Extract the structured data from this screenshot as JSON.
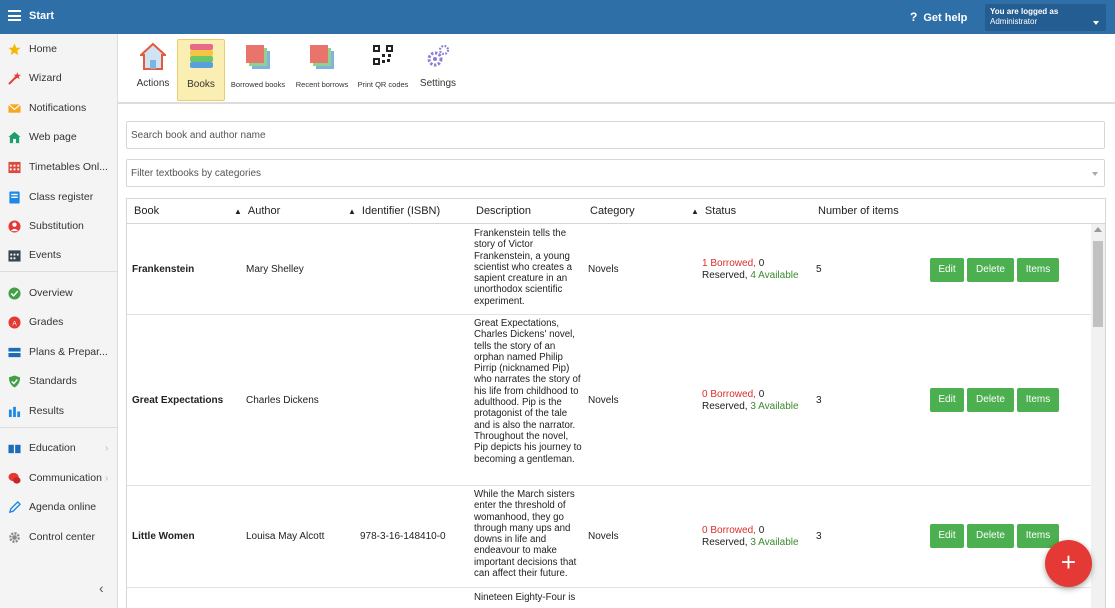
{
  "topbar": {
    "title": "Start",
    "help_q": "?",
    "help": "Get help",
    "logged_as": "You are logged as",
    "user": "Administrator"
  },
  "sidebar": {
    "items": [
      {
        "label": "Home",
        "icon": "star-icon"
      },
      {
        "label": "Wizard",
        "icon": "wand-icon"
      },
      {
        "label": "Notifications",
        "icon": "envelope-icon"
      },
      {
        "label": "Web page",
        "icon": "home-icon"
      },
      {
        "label": "Timetables Onl...",
        "icon": "calendar-icon"
      },
      {
        "label": "Class register",
        "icon": "book-icon"
      },
      {
        "label": "Substitution",
        "icon": "person-icon"
      },
      {
        "label": "Events",
        "icon": "events-icon"
      },
      {
        "label": "Overview",
        "icon": "check-circle-icon"
      },
      {
        "label": "Grades",
        "icon": "grades-icon"
      },
      {
        "label": "Plans & Prepar...",
        "icon": "plans-icon"
      },
      {
        "label": "Standards",
        "icon": "shield-icon"
      },
      {
        "label": "Results",
        "icon": "bar-chart-icon"
      },
      {
        "label": "Education",
        "icon": "education-icon"
      },
      {
        "label": "Communication",
        "icon": "chat-icon"
      },
      {
        "label": "Agenda online",
        "icon": "pen-icon"
      },
      {
        "label": "Control center",
        "icon": "gear-icon"
      }
    ],
    "chevron": "›",
    "collapse": "‹"
  },
  "toolbar": {
    "actions": "Actions",
    "books": "Books",
    "borrowed": "Borrowed books",
    "recent": "Recent borrows",
    "qr": "Print QR codes",
    "settings": "Settings"
  },
  "search": {
    "placeholder": "Search book and author name"
  },
  "filter": {
    "placeholder": "Filter textbooks by categories"
  },
  "table": {
    "headers": {
      "book": "Book",
      "author": "Author",
      "isbn": "Identifier (ISBN)",
      "description": "Description",
      "category": "Category",
      "status": "Status",
      "items": "Number of items"
    },
    "sort_arrow": "▲",
    "rows": [
      {
        "book": "Frankenstein",
        "author": "Mary Shelley",
        "isbn": "",
        "description": "Frankenstein tells the story of Victor Frankenstein, a young scientist who creates a sapient creature in an unorthodox scientific experiment.",
        "category": "Novels",
        "borrowed": "1 Borrowed,",
        "reserved_num": " 0",
        "reserved": "Reserved,",
        "available": "4 Available",
        "items": "5"
      },
      {
        "book": "Great Expectations",
        "author": "Charles Dickens",
        "isbn": "",
        "description": "Great Expectations, Charles Dickens' novel, tells the story of an orphan named Philip Pirrip (nicknamed Pip) who narrates the story of his life from childhood to adulthood. Pip is the protagonist of the tale and is also the narrator. Throughout the novel, Pip depicts his journey to becoming a gentleman.",
        "category": "Novels",
        "borrowed": "0 Borrowed,",
        "reserved_num": " 0",
        "reserved": "Reserved,",
        "available": "3 Available",
        "items": "3"
      },
      {
        "book": "Little Women",
        "author": "Louisa May Alcott",
        "isbn": "978-3-16-148410-0",
        "description": "While the March sisters enter the threshold of womanhood, they go through many ups and downs in life and endeavour to make important decisions that can affect their future.",
        "category": "Novels",
        "borrowed": "0 Borrowed,",
        "reserved_num": " 0",
        "reserved": "Reserved,",
        "available": "3 Available",
        "items": "3"
      },
      {
        "book": "",
        "author": "",
        "isbn": "",
        "description": "Nineteen Eighty-Four is",
        "category": "",
        "borrowed": "",
        "reserved_num": "",
        "reserved": "",
        "available": "",
        "items": ""
      }
    ],
    "buttons": {
      "edit": "Edit",
      "delete": "Delete",
      "items": "Items"
    }
  },
  "fab": "+",
  "colors": {
    "topbar": "#2f6fa8",
    "button": "#4caf50",
    "fab": "#e53935",
    "borrowed": "#d9302a",
    "available": "#3b8a2d"
  }
}
